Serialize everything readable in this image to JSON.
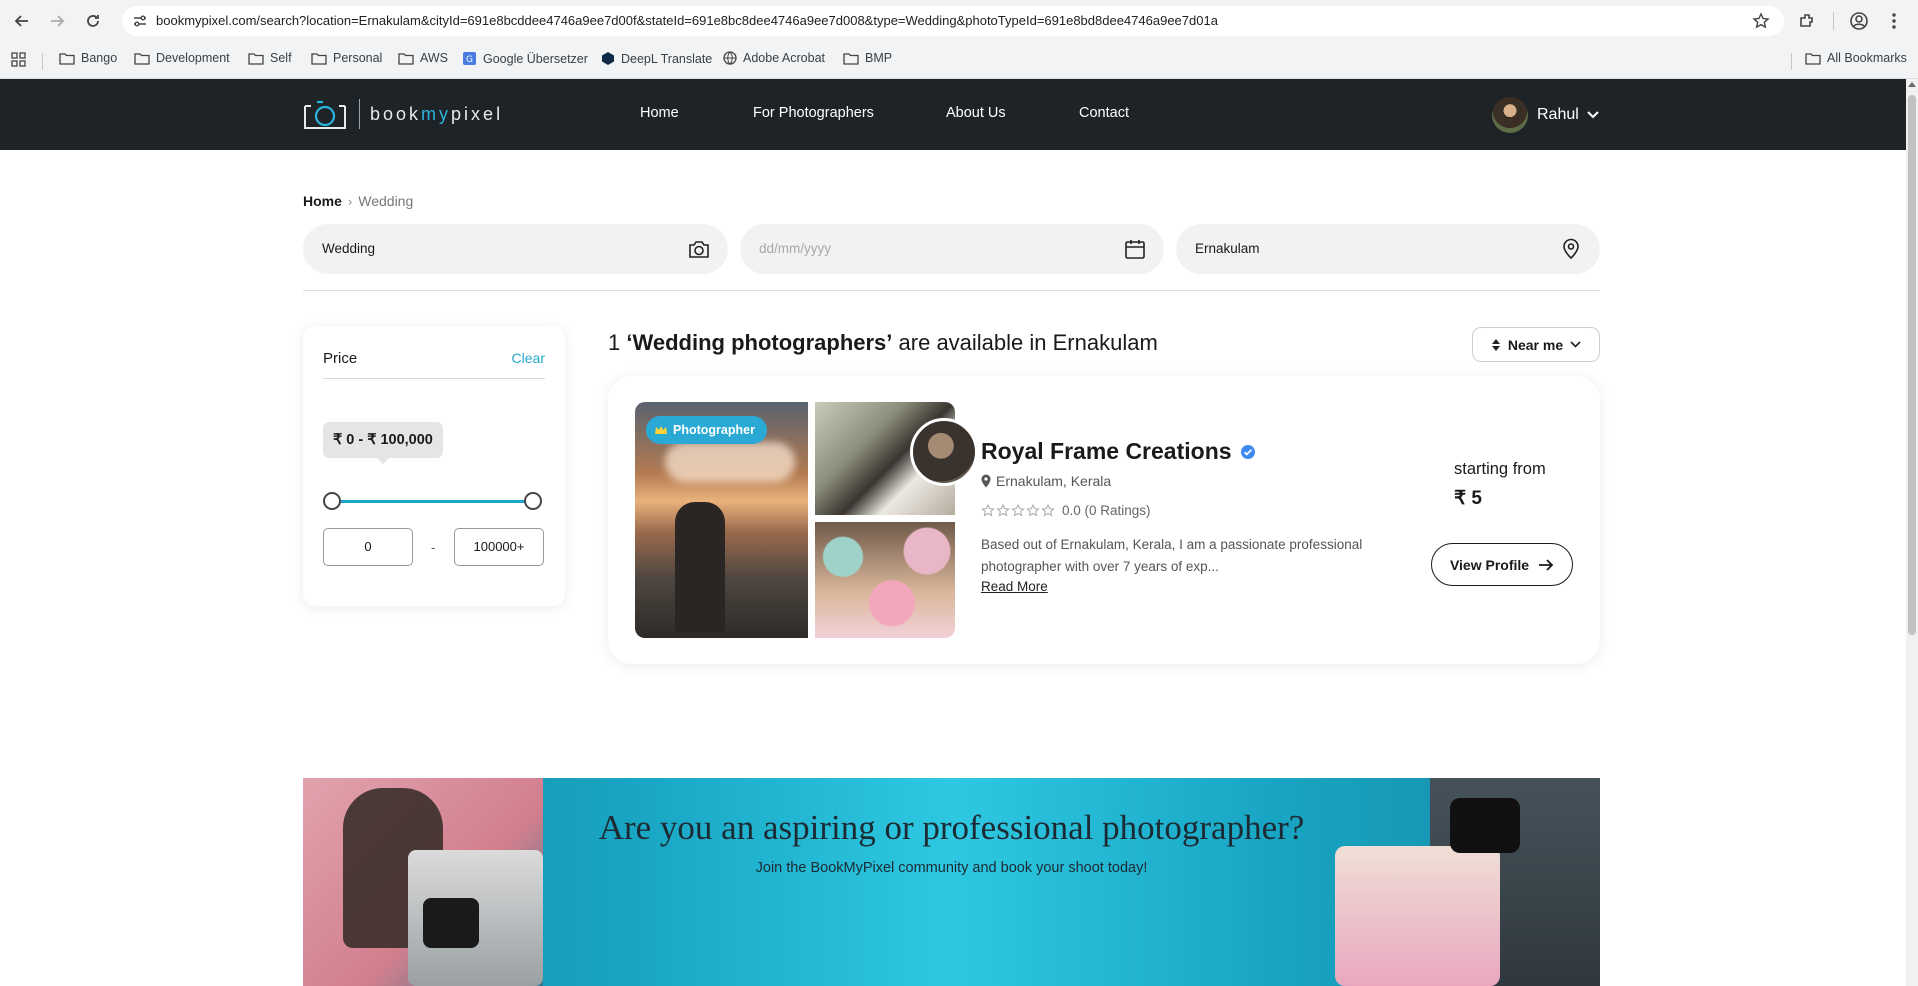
{
  "browser": {
    "url": "bookmypixel.com/search?location=Ernakulam&cityId=691e8bcddee4746a9ee7d00f&stateId=691e8bc8dee4746a9ee7d008&type=Wedding&photoTypeId=691e8bd8dee4746a9ee7d01a",
    "bookmarks": [
      "Bango",
      "Development",
      "Self",
      "Personal",
      "AWS",
      "Google Übersetzer",
      "DeepL Translate",
      "Adobe Acrobat",
      "BMP"
    ],
    "all_bookmarks": "All Bookmarks"
  },
  "header": {
    "logo": {
      "prefix": "book",
      "accent": "my",
      "suffix": "pixel"
    },
    "nav": [
      "Home",
      "For Photographers",
      "About Us",
      "Contact"
    ],
    "user_name": "Rahul"
  },
  "breadcrumb": {
    "home": "Home",
    "separator": "›",
    "current": "Wedding"
  },
  "search": {
    "type_value": "Wedding",
    "date_placeholder": "dd/mm/yyyy",
    "location_value": "Ernakulam"
  },
  "filter": {
    "title": "Price",
    "clear_label": "Clear",
    "range_label": "₹ 0 - ₹ 100,000",
    "min_value": "0",
    "max_value": "100000+",
    "dash": "-"
  },
  "results": {
    "count": "1",
    "heading_bold": "‘Wedding photographers’",
    "heading_suffix": "are available in Ernakulam",
    "sort_label": "Near me"
  },
  "listing": {
    "badge": "Photographer",
    "name": "Royal Frame Creations",
    "location": "Ernakulam, Kerala",
    "rating": "0.0 (0 Ratings)",
    "description": "Based out of Ernakulam, Kerala, I am a passionate professional photographer with over 7 years of exp...",
    "read_more": "Read More",
    "starting_label": "starting from",
    "price": "₹ 5",
    "view_profile": "View Profile"
  },
  "banner": {
    "title": "Are you an aspiring or professional photographer?",
    "subtitle": "Join the BookMyPixel community and book your shoot today!"
  },
  "colors": {
    "header_bg": "#1e2328",
    "accent": "#29a9d3",
    "banner": "#2ec8e2"
  }
}
